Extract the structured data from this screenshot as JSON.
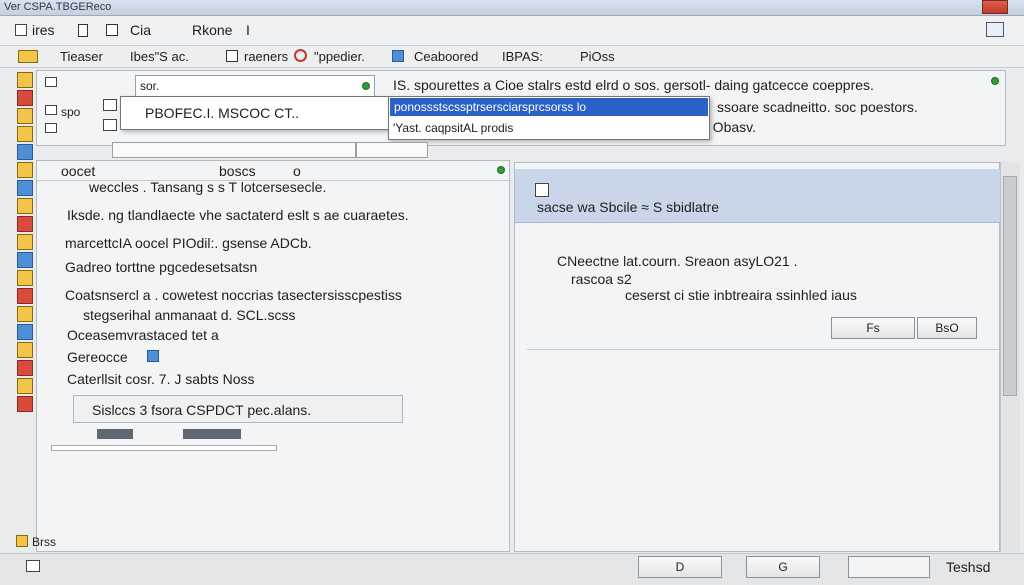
{
  "window": {
    "title": "Ver CSPA.TBGEReco"
  },
  "menubar": {
    "items": [
      "ires",
      "Cia",
      "Rkone",
      "I"
    ]
  },
  "toolbar": {
    "items": [
      "Tieaser",
      "Ibes\"S ac.",
      "raeners",
      "\"ppedier.",
      "Ceaboored",
      "IBPAS:",
      "PiOss"
    ]
  },
  "top_panel": {
    "field_left": "sor.",
    "row2_left": "spo",
    "text_right_1": "IS. spourettes a Cioe stalrs estd elrd o sos. gersotl- daing gatcecce coeppres.",
    "text_right_2": "ssoare scadneitto. soc poestors.",
    "text_right_3": "o Obasv.",
    "dropdown_header": "PBOFEC.I. MSCOC CT..",
    "dropdown_items": [
      "ponossstscssptrsersciarsprcsorss lo",
      "'Yast. caqpsitAL  prodis"
    ]
  },
  "left_list": {
    "header_left": "oocet",
    "header_mid": "boscs",
    "header_right": "o",
    "lines": [
      "weccles . Tansang s s T lotcersesecle.",
      "Iksde.  ng tlandlaecte vhe sactaterd eslt s  ae cuaraetes.",
      "marcettcIA oocel PIOdil:.  gsense ADCb.",
      "Gadreo torttne pgcedesetsatsn",
      "Coatsnsercl a  . cowetest noccrias tasectersisscpestiss",
      "stegserihal anmanaat d.  SCL.scss",
      "Oceasemvrastaced tet a",
      "Gereocce",
      "Caterllsit cosr.  7. J sabts Noss",
      "Sislccs 3   fsora CSPDCT pec.alans."
    ]
  },
  "dialog": {
    "header": "sacse wa Sbcile  ≈ S sbidlatre",
    "text_1": "CNeectne lat.courn. Sreaon asyLO21 .",
    "text_2": "rascoa s2",
    "text_3": "ceserst ci stie inbtreaira ssinhled iaus",
    "button_ok": "Fs",
    "button_other": "BsO"
  },
  "statusbar": {
    "left": "Brss",
    "btn1": "D",
    "btn2": "G",
    "right": "Teshsd"
  }
}
